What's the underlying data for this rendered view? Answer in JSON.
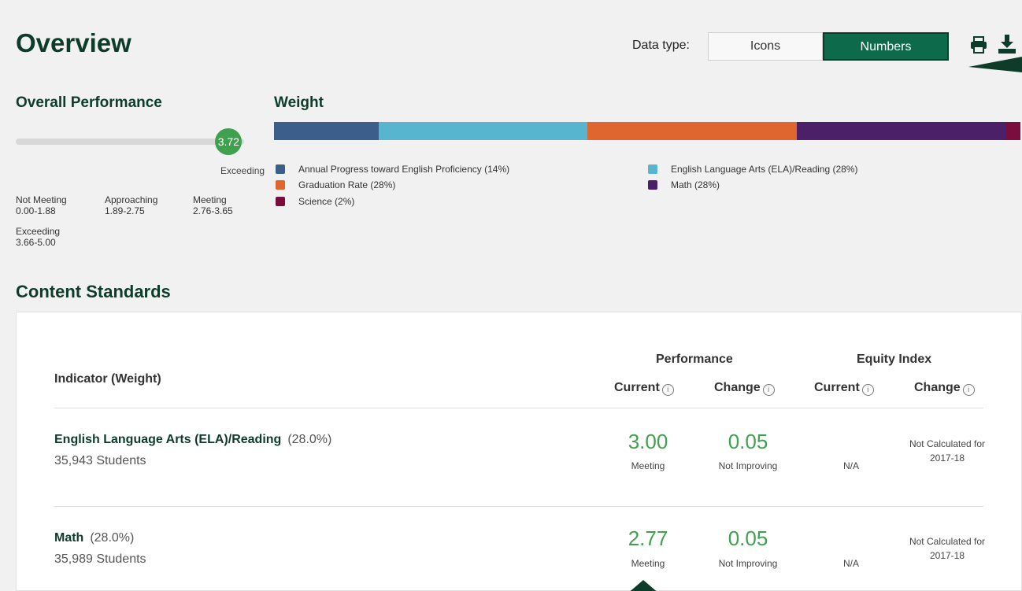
{
  "header": {
    "title": "Overview",
    "data_type_label": "Data type:",
    "toggle_icons": "Icons",
    "toggle_numbers": "Numbers"
  },
  "overall": {
    "heading": "Overall Performance",
    "score": "3.72",
    "score_fraction": 0.744,
    "score_level": "Exceeding",
    "ranges": [
      {
        "label": "Not Meeting",
        "range": "0.00-1.88"
      },
      {
        "label": "Approaching",
        "range": "1.89-2.75"
      },
      {
        "label": "Meeting",
        "range": "2.76-3.65"
      },
      {
        "label": "Exceeding",
        "range": "3.66-5.00"
      }
    ]
  },
  "weight": {
    "heading": "Weight",
    "segments": [
      {
        "label": "Annual Progress toward English Proficiency (14%)",
        "pct": 14,
        "color": "#3b5f8a"
      },
      {
        "label": "English Language Arts (ELA)/Reading (28%)",
        "pct": 28,
        "color": "#57b5d0"
      },
      {
        "label": "Graduation Rate (28%)",
        "pct": 28,
        "color": "#e0662f"
      },
      {
        "label": "Math (28%)",
        "pct": 28,
        "color": "#4c2068"
      },
      {
        "label": "Science (2%)",
        "pct": 2,
        "color": "#7a0c3e"
      }
    ]
  },
  "content_standards": {
    "heading": "Content Standards",
    "col_indicator": "Indicator (Weight)",
    "group_performance": "Performance",
    "group_equity": "Equity Index",
    "col_current": "Current",
    "col_change": "Change",
    "info_glyph": "i",
    "rows": [
      {
        "name": "English Language Arts (ELA)/Reading",
        "weight": "(28.0%)",
        "students": "35,943 Students",
        "perf_current": "3.00",
        "perf_current_label": "Meeting",
        "perf_change": "0.05",
        "perf_change_label": "Not Improving",
        "equity_current": "N/A",
        "equity_change": "Not Calculated for 2017-18"
      },
      {
        "name": "Math",
        "weight": "(28.0%)",
        "students": "35,989 Students",
        "perf_current": "2.77",
        "perf_current_label": "Meeting",
        "perf_change": "0.05",
        "perf_change_label": "Not Improving",
        "equity_current": "N/A",
        "equity_change": "Not Calculated for 2017-18"
      }
    ]
  }
}
